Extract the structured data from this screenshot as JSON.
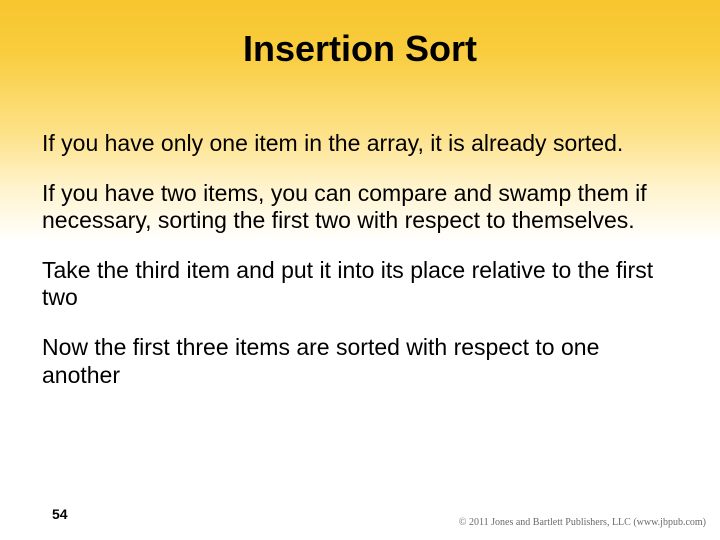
{
  "title": "Insertion Sort",
  "paragraphs": {
    "p1": "If you have only one item in the array, it is already sorted.",
    "p2": "If you have two items, you can compare and swamp them if necessary, sorting the first two with respect to themselves.",
    "p3": "Take the third item and put it into its place relative to the first two",
    "p4": "Now the first three items are sorted with respect to one another"
  },
  "page_number": "54",
  "copyright": "© 2011 Jones and Bartlett Publishers, LLC (www.jbpub.com)"
}
